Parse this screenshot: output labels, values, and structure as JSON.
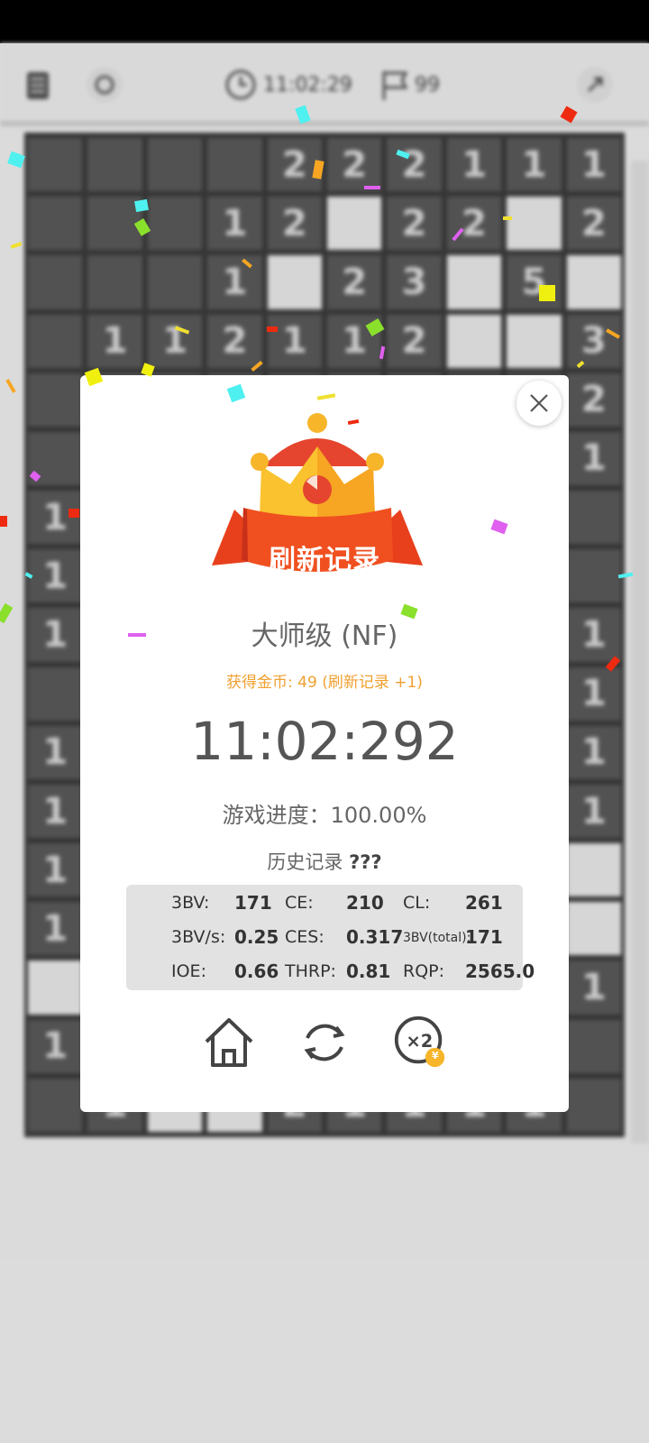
{
  "toolbar": {
    "icons": [
      "document-icon",
      "refresh-icon",
      "clock-icon",
      "flag-icon",
      "expand-icon"
    ],
    "timer": "11:02:29",
    "flags": "99"
  },
  "board": {
    "cells": [
      [
        "",
        "",
        "",
        "",
        "2",
        "2",
        "2",
        "1",
        "1",
        "1"
      ],
      [
        "",
        "",
        "",
        "1",
        "2",
        "",
        "2",
        "2",
        "",
        "2"
      ],
      [
        "",
        "",
        "",
        "1",
        "",
        "2",
        "3",
        "",
        "5",
        ""
      ],
      [
        "",
        "1",
        "1",
        "2",
        "1",
        "1",
        "2",
        "",
        "",
        "3"
      ],
      [
        "",
        "",
        "",
        "",
        "",
        "",
        "",
        "",
        "",
        "2"
      ],
      [
        "",
        "",
        "",
        "",
        "",
        "",
        "",
        "",
        "",
        "1"
      ],
      [
        "1",
        "",
        "",
        "",
        "",
        "",
        "",
        "",
        "",
        ""
      ],
      [
        "1",
        "",
        "",
        "",
        "",
        "",
        "",
        "",
        "",
        ""
      ],
      [
        "1",
        "",
        "",
        "",
        "",
        "",
        "",
        "",
        "",
        "1"
      ],
      [
        "",
        "",
        "",
        "",
        "",
        "",
        "",
        "",
        "",
        "1"
      ],
      [
        "1",
        "",
        "",
        "",
        "",
        "",
        "",
        "",
        "",
        "1"
      ],
      [
        "1",
        "",
        "",
        "",
        "",
        "",
        "",
        "",
        "",
        "1"
      ],
      [
        "1",
        "",
        "",
        "",
        "",
        "",
        "",
        "",
        "",
        ""
      ],
      [
        "1",
        "",
        "",
        "",
        "",
        "",
        "",
        "",
        "",
        ""
      ],
      [
        "",
        "",
        "",
        "",
        "",
        "",
        "",
        "",
        "",
        "1"
      ],
      [
        "1",
        "",
        "",
        "",
        "",
        "",
        "",
        "",
        "",
        ""
      ],
      [
        "",
        "1",
        "",
        "",
        "2",
        "1",
        "1",
        "1",
        "1",
        ""
      ]
    ],
    "open": [
      [
        1,
        5
      ],
      [
        1,
        8
      ],
      [
        2,
        4
      ],
      [
        2,
        7
      ],
      [
        2,
        9
      ],
      [
        3,
        7
      ],
      [
        3,
        8
      ],
      [
        12,
        9
      ],
      [
        13,
        9
      ],
      [
        14,
        0
      ],
      [
        16,
        2
      ],
      [
        16,
        3
      ]
    ]
  },
  "dialog": {
    "banner": "刷新记录",
    "level": "大师级 (NF)",
    "coins": "获得金币: 49 (刷新记录 +1)",
    "time": "11:02:292",
    "progress": "游戏进度：100.00%",
    "history_label": "历史记录",
    "history_value": "???",
    "stats": {
      "bbbv_label": "3BV:",
      "bbbv": "171",
      "ce_label": "CE:",
      "ce": "210",
      "cl_label": "CL:",
      "cl": "261",
      "bbbvs_label": "3BV/s:",
      "bbbvs": "0.25",
      "ces_label": "CES:",
      "ces": "0.317",
      "bbbvt_label": "3BV(total):",
      "bbbvt": "171",
      "ioe_label": "IOE:",
      "ioe": "0.66",
      "thrp_label": "THRP:",
      "thrp": "0.81",
      "rqp_label": "RQP:",
      "rqp": "2565.0"
    },
    "buttons": [
      "home-icon",
      "replay-icon",
      "double-coins-icon"
    ],
    "coin_badge": "¥"
  },
  "colors": {
    "accent_orange": "#f0a030",
    "banner_red": "#e8401c",
    "crown_gold": "#f7b52a"
  }
}
